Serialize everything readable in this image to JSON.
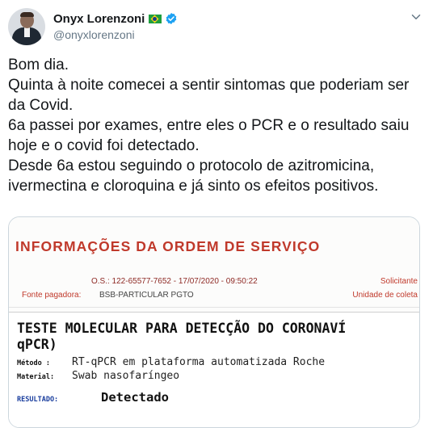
{
  "tweet": {
    "display_name": "Onyx Lorenzoni",
    "handle": "@onyxlorenzoni",
    "flag_icon": "brazil-flag-icon",
    "verified_icon": "verified-badge-icon",
    "menu_icon": "chevron-down-icon",
    "verified_color": "#1da1f2",
    "text_lines": [
      "Bom dia.",
      "Quinta à noite comecei a sentir sintomas que poderiam ser da Covid.",
      "6a passei por exames, entre eles o PCR e o resultado saiu hoje e o covid foi detectado.",
      "Desde 6a estou seguindo o protocolo de azitromicina, ivermectina e cloroquina e já sinto os efeitos positivos."
    ]
  },
  "document": {
    "title": "INFORMAÇÕES DA ORDEM DE SERVIÇO",
    "os_line": "O.S.: 122-65577-7652 - 17/07/2020 - 09:50:22",
    "solicitante": "Solicitante",
    "fonte_label": "Fonte pagadora:",
    "fonte_value": "BSB-PARTICULAR PGTO",
    "unidade": "Unidade de coleta",
    "test_title_line1": "TESTE MOLECULAR PARA DETECÇÃO DO CORONAVÍ",
    "test_title_line2": "qPCR)",
    "metodo_label": "Método :",
    "metodo_value": "RT-qPCR em plataforma automatizada Roche",
    "material_label": "Material:",
    "material_value": "Swab nasofaríngeo",
    "resultado_label": "RESULTADO:",
    "resultado_value": "Detectado",
    "accent_color": "#c0392b"
  }
}
